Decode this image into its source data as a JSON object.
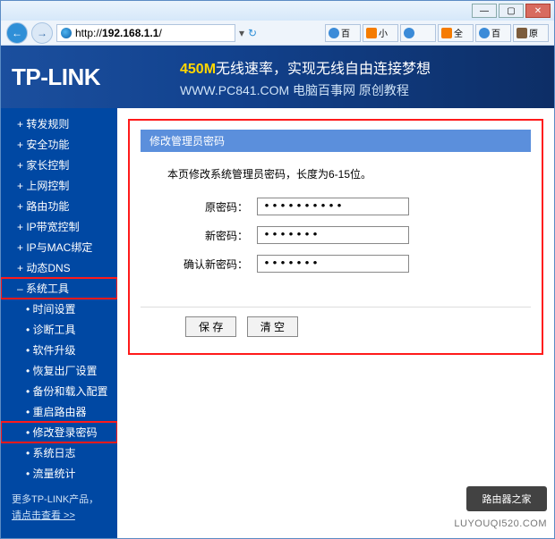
{
  "browser": {
    "url_prefix": "http://",
    "url_host": "192.168.1.1",
    "url_suffix": "/",
    "tabs": [
      {
        "label": "百"
      },
      {
        "label": "小"
      },
      {
        "label": ""
      },
      {
        "label": "全"
      },
      {
        "label": "百"
      },
      {
        "label": "原"
      }
    ]
  },
  "banner": {
    "logo": "TP-LINK",
    "slogan_speed": "450M",
    "slogan_rest": "无线速率，实现无线自由连接梦想",
    "subline": "WWW.PC841.COM 电脑百事网 原创教程"
  },
  "sidebar": {
    "items": [
      {
        "label": "转发规则",
        "type": "item"
      },
      {
        "label": "安全功能",
        "type": "item"
      },
      {
        "label": "家长控制",
        "type": "item"
      },
      {
        "label": "上网控制",
        "type": "item"
      },
      {
        "label": "路由功能",
        "type": "item"
      },
      {
        "label": "IP带宽控制",
        "type": "item"
      },
      {
        "label": "IP与MAC绑定",
        "type": "item"
      },
      {
        "label": "动态DNS",
        "type": "item"
      },
      {
        "label": "系统工具",
        "type": "item-expanded",
        "highlight": true
      },
      {
        "label": "时间设置",
        "type": "sub"
      },
      {
        "label": "诊断工具",
        "type": "sub"
      },
      {
        "label": "软件升级",
        "type": "sub"
      },
      {
        "label": "恢复出厂设置",
        "type": "sub"
      },
      {
        "label": "备份和载入配置",
        "type": "sub"
      },
      {
        "label": "重启路由器",
        "type": "sub"
      },
      {
        "label": "修改登录密码",
        "type": "sub",
        "highlight": true
      },
      {
        "label": "系统日志",
        "type": "sub"
      },
      {
        "label": "流量统计",
        "type": "sub"
      }
    ],
    "footer_line1": "更多TP-LINK产品，",
    "footer_line2": "请点击查看 >>"
  },
  "panel": {
    "title": "修改管理员密码",
    "description": "本页修改系统管理员密码，长度为6-15位。",
    "fields": {
      "old_label": "原密码：",
      "old_value": "••••••••••",
      "new_label": "新密码：",
      "new_value": "•••••••",
      "confirm_label": "确认新密码：",
      "confirm_value": "•••••••"
    },
    "buttons": {
      "save": "保 存",
      "clear": "清 空"
    }
  },
  "watermark": {
    "box": "路由器之家",
    "url": "LUYOUQI520.COM"
  }
}
